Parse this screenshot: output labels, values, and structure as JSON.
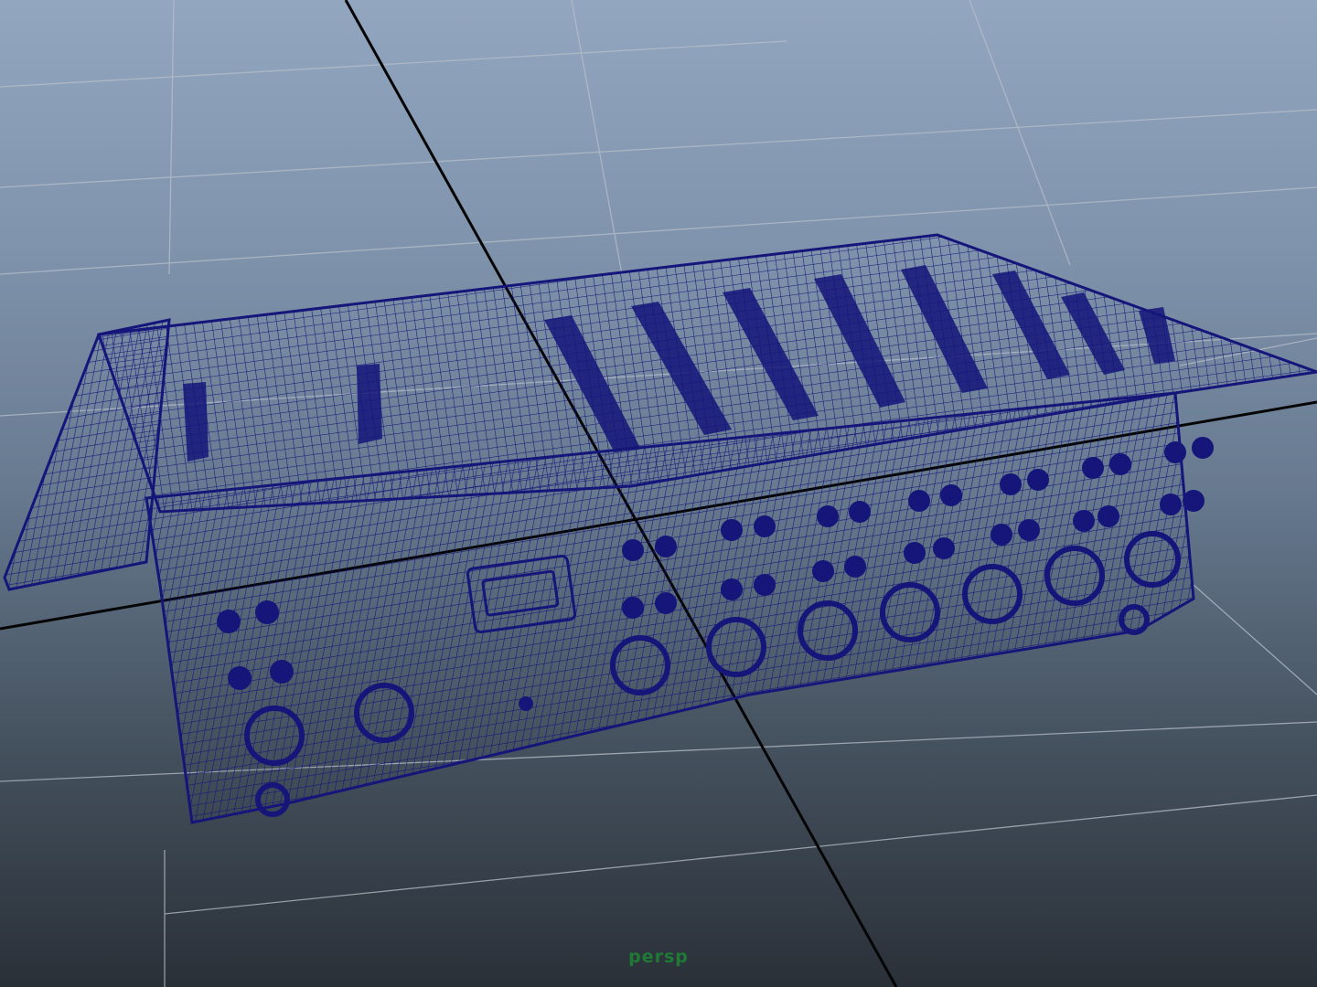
{
  "viewport": {
    "camera_name": "persp",
    "label_color": "#1f7a35",
    "background_top": "#93a6c0",
    "background_bottom": "#2a3038"
  },
  "scene": {
    "display_mode": "wireframe",
    "object": "audio-mixer-model",
    "wireframe_color": "#15157a",
    "grid_color": "#b8bfc9",
    "axis_color": "#050505"
  }
}
